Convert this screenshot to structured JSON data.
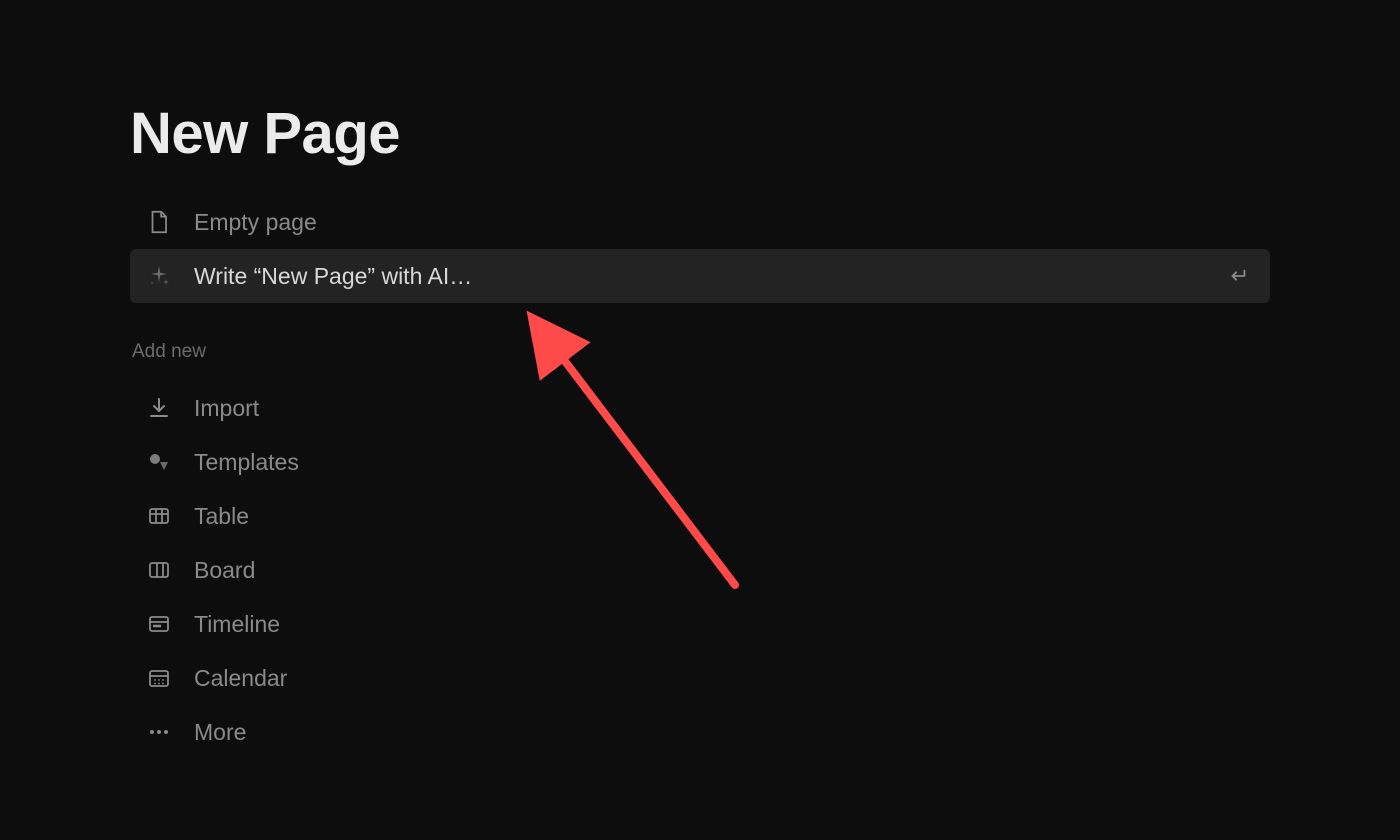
{
  "page": {
    "title": "New Page"
  },
  "options": {
    "empty_page": {
      "label": "Empty page"
    },
    "write_with_ai": {
      "label": "Write “New Page” with AI…"
    }
  },
  "add_new": {
    "header": "Add new",
    "items": [
      {
        "label": "Import",
        "icon": "import"
      },
      {
        "label": "Templates",
        "icon": "templates"
      },
      {
        "label": "Table",
        "icon": "table"
      },
      {
        "label": "Board",
        "icon": "board"
      },
      {
        "label": "Timeline",
        "icon": "timeline"
      },
      {
        "label": "Calendar",
        "icon": "calendar"
      },
      {
        "label": "More",
        "icon": "more"
      }
    ]
  },
  "annotation": {
    "arrow_color": "#ff4a4a"
  }
}
